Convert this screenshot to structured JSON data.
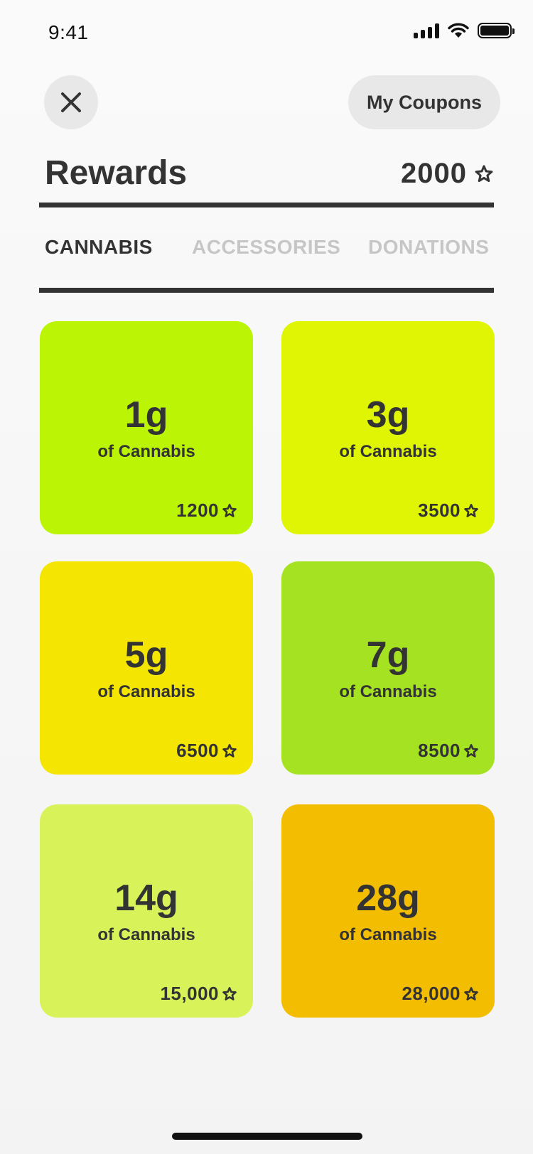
{
  "status": {
    "time": "9:41"
  },
  "header": {
    "coupons_label": "My Coupons",
    "title": "Rewards",
    "points": "2000"
  },
  "tabs": [
    {
      "label": "CANNABIS",
      "active": true
    },
    {
      "label": "ACCESSORIES",
      "active": false
    },
    {
      "label": "DONATIONS",
      "active": false
    }
  ],
  "rewards": [
    {
      "amount": "1g",
      "desc": "of Cannabis",
      "price": "1200",
      "color": "#bbf505"
    },
    {
      "amount": "3g",
      "desc": "of Cannabis",
      "price": "3500",
      "color": "#e0f504"
    },
    {
      "amount": "5g",
      "desc": "of Cannabis",
      "price": "6500",
      "color": "#f5e503"
    },
    {
      "amount": "7g",
      "desc": "of Cannabis",
      "price": "8500",
      "color": "#a5e322"
    },
    {
      "amount": "14g",
      "desc": "of Cannabis",
      "price": "15,000",
      "color": "#d8f25a"
    },
    {
      "amount": "28g",
      "desc": "of Cannabis",
      "price": "28,000",
      "color": "#f3bd02"
    }
  ],
  "icons": {
    "close": "close-icon",
    "star": "star-outline-icon"
  }
}
